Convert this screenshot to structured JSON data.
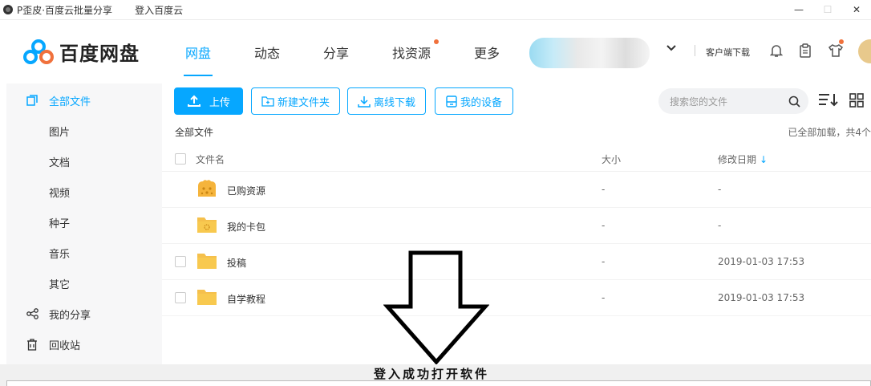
{
  "titlebar": {
    "app_title": "P歪皮·百度云批量分享",
    "login_menu": "登入百度云",
    "minimize": "—",
    "maximize": "☐",
    "close": "✕"
  },
  "brand": {
    "name": "百度网盘",
    "colors": {
      "blue": "#06a7ff",
      "orange": "#f0713c"
    }
  },
  "nav": {
    "items": [
      {
        "label": "网盘",
        "active": true
      },
      {
        "label": "动态"
      },
      {
        "label": "分享"
      },
      {
        "label": "找资源",
        "badge_dot": true
      },
      {
        "label": "更多"
      }
    ],
    "client_download": "客户端下载"
  },
  "sidebar": {
    "items": [
      {
        "label": "全部文件",
        "icon": "files-icon",
        "active": true
      },
      {
        "label": "图片"
      },
      {
        "label": "文档"
      },
      {
        "label": "视频"
      },
      {
        "label": "种子"
      },
      {
        "label": "音乐"
      },
      {
        "label": "其它"
      },
      {
        "label": "我的分享",
        "icon": "share-icon"
      },
      {
        "label": "回收站",
        "icon": "trash-icon"
      }
    ]
  },
  "toolbar": {
    "upload": "上传",
    "new_folder": "新建文件夹",
    "offline_download": "离线下载",
    "my_devices": "我的设备",
    "search_placeholder": "搜索您的文件"
  },
  "breadcrumb": "全部文件",
  "load_status": "已全部加载，共4个",
  "table": {
    "headers": {
      "name": "文件名",
      "size": "大小",
      "date": "修改日期"
    },
    "rows": [
      {
        "name": "已购资源",
        "size": "-",
        "date": "-",
        "icon": "purchased-folder-icon",
        "checkbox": false
      },
      {
        "name": "我的卡包",
        "size": "-",
        "date": "-",
        "icon": "card-folder-icon",
        "checkbox": false
      },
      {
        "name": "投稿",
        "size": "-",
        "date": "2019-01-03 17:53",
        "icon": "folder-icon",
        "checkbox": true
      },
      {
        "name": "自学教程",
        "size": "-",
        "date": "2019-01-03 17:53",
        "icon": "folder-icon",
        "checkbox": true
      }
    ]
  },
  "annotation": "登入成功打开软件"
}
